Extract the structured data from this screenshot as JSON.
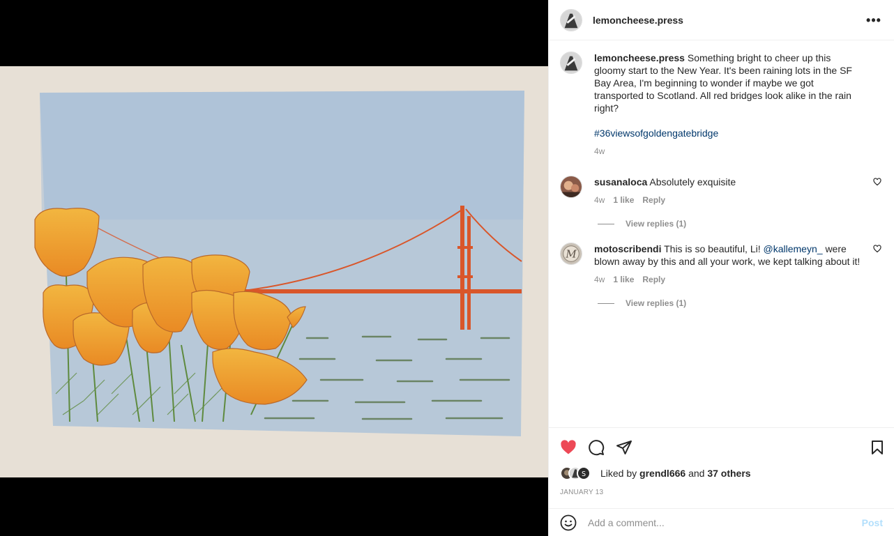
{
  "post": {
    "author": "lemoncheese.press",
    "more_icon": "more-horizontal-icon",
    "caption": {
      "text": "Something bright to cheer up this gloomy start to the New Year. It's been raining lots in the SF Bay Area, I'm beginning to wonder if maybe we got transported to Scotland. All red bridges look alike in the rain right?",
      "hashtag": "#36viewsofgoldengatebridge",
      "time": "4w"
    }
  },
  "comments": [
    {
      "username": "susanaloca",
      "text": "Absolutely exquisite",
      "mention": "",
      "text_after": "",
      "time": "4w",
      "likes": "1 like",
      "reply_label": "Reply",
      "view_replies": "View replies (1)"
    },
    {
      "username": "motoscribendi",
      "text": "This is so beautiful, Li!",
      "mention": "@kallemeyn_",
      "text_after": "were blown away by this and all your work, we kept talking about it!",
      "time": "4w",
      "likes": "1 like",
      "reply_label": "Reply",
      "view_replies": "View replies (1)"
    }
  ],
  "likes": {
    "prefix": "Liked by",
    "user": "grendl666",
    "and": "and",
    "others": "37 others"
  },
  "date": "JANUARY 13",
  "add_comment": {
    "placeholder": "Add a comment...",
    "post_label": "Post"
  },
  "colors": {
    "like_red": "#ed4956",
    "link_blue": "#00376b",
    "post_disabled": "#b2dffc"
  }
}
